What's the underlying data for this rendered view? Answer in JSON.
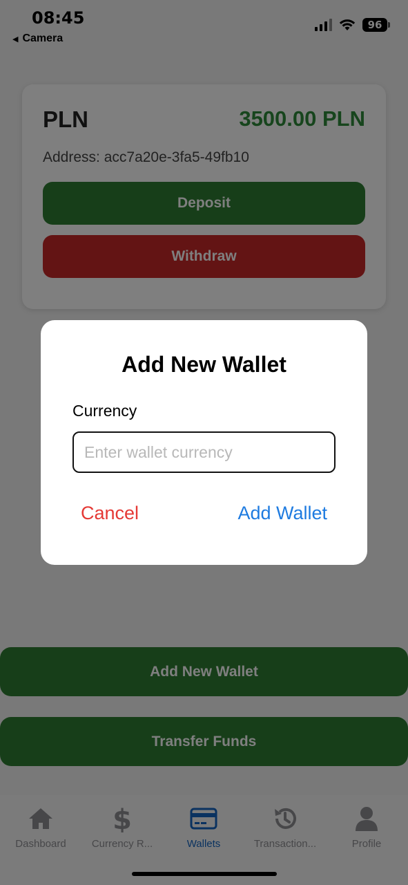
{
  "status_bar": {
    "time": "08:45",
    "back_app": "Camera",
    "battery": "96"
  },
  "wallet": {
    "currency": "PLN",
    "balance": "3500.00 PLN",
    "address": "Address: acc7a20e-3fa5-49fb10",
    "deposit_label": "Deposit",
    "withdraw_label": "Withdraw"
  },
  "actions": {
    "add_wallet_label": "Add New Wallet",
    "transfer_label": "Transfer Funds"
  },
  "modal": {
    "title": "Add New Wallet",
    "field_label": "Currency",
    "input_value": "",
    "input_placeholder": "Enter wallet currency",
    "cancel_label": "Cancel",
    "confirm_label": "Add Wallet"
  },
  "tabs": [
    {
      "label": "Dashboard",
      "icon": "home-icon"
    },
    {
      "label": "Currency R...",
      "icon": "dollar-icon"
    },
    {
      "label": "Wallets",
      "icon": "card-icon"
    },
    {
      "label": "Transaction...",
      "icon": "history-icon"
    },
    {
      "label": "Profile",
      "icon": "person-icon"
    }
  ],
  "colors": {
    "deposit": "#2e7d32",
    "withdraw": "#c62828",
    "balance": "#2e8b3a",
    "active_tab": "#1565c0",
    "inactive_tab": "#8e8e93",
    "cancel": "#e53935",
    "confirm": "#1e7be0"
  }
}
